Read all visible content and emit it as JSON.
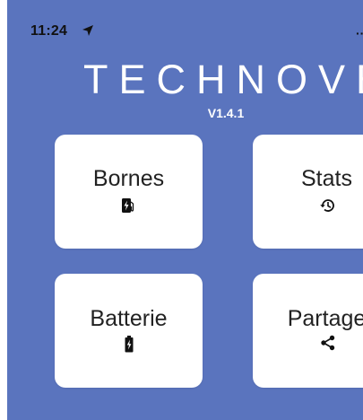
{
  "status_bar": {
    "time": "11:24",
    "location_icon": "location-arrow-icon"
  },
  "header": {
    "title": "TECHNOVE",
    "version": "V1.4.1"
  },
  "menu": [
    {
      "label": "Bornes",
      "icon": "charging-station-icon"
    },
    {
      "label": "Stats",
      "icon": "history-icon"
    },
    {
      "label": "Batterie",
      "icon": "battery-charging-icon"
    },
    {
      "label": "Partage",
      "icon": "share-icon"
    }
  ],
  "colors": {
    "background": "#5a74be",
    "card": "#ffffff",
    "text_dark": "#222222",
    "title": "#ffffff"
  }
}
